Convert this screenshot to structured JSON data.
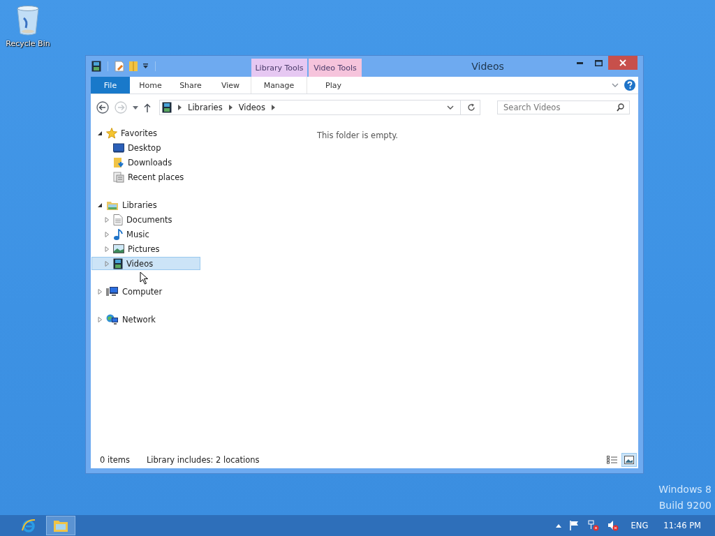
{
  "desktop_icons": [
    {
      "label": "Recycle Bin"
    }
  ],
  "window": {
    "title": "Videos",
    "contextual_headers": [
      {
        "label": "Library Tools",
        "color": "#e6c8f2"
      },
      {
        "label": "Video Tools",
        "color": "#f6c4dc"
      }
    ],
    "ribbon_tabs": [
      {
        "label": "File",
        "kind": "file",
        "selected": false
      },
      {
        "label": "Home",
        "kind": "plain",
        "selected": false
      },
      {
        "label": "Share",
        "kind": "plain",
        "selected": false
      },
      {
        "label": "View",
        "kind": "plain",
        "selected": false
      },
      {
        "label": "Manage",
        "kind": "contextual",
        "selected": false
      },
      {
        "label": "Play",
        "kind": "contextual",
        "selected": false
      }
    ],
    "address": {
      "crumbs": [
        "Libraries",
        "Videos"
      ]
    },
    "search": {
      "placeholder": "Search Videos"
    },
    "nav_tree": [
      {
        "label": "Favorites",
        "kind": "star",
        "expanded": true,
        "selected": false,
        "children": [
          {
            "label": "Desktop",
            "kind": "desktop",
            "selected": false
          },
          {
            "label": "Downloads",
            "kind": "downloads",
            "selected": false
          },
          {
            "label": "Recent places",
            "kind": "recent",
            "selected": false
          }
        ]
      },
      {
        "label": "Libraries",
        "kind": "library",
        "expanded": true,
        "selected": false,
        "children": [
          {
            "label": "Documents",
            "kind": "documents",
            "expanded": false,
            "selected": false
          },
          {
            "label": "Music",
            "kind": "music",
            "expanded": false,
            "selected": false
          },
          {
            "label": "Pictures",
            "kind": "pictures",
            "expanded": false,
            "selected": false
          },
          {
            "label": "Videos",
            "kind": "videos",
            "expanded": false,
            "selected": true
          }
        ]
      },
      {
        "label": "Computer",
        "kind": "computer",
        "expanded": false,
        "selected": false
      },
      {
        "label": "Network",
        "kind": "network",
        "expanded": false,
        "selected": false
      }
    ],
    "empty_message": "This folder is empty.",
    "status_bar": {
      "item_count": "0 items",
      "library_info": "Library includes: 2 locations",
      "view_buttons": [
        {
          "kind": "details",
          "selected": false
        },
        {
          "kind": "large-icons",
          "selected": true
        }
      ]
    }
  },
  "os_version": [
    "Windows 8",
    "Build 9200"
  ],
  "taskbar": {
    "apps": [
      {
        "kind": "browser",
        "selected": false
      },
      {
        "kind": "explorer",
        "selected": true
      }
    ],
    "language": "ENG",
    "clock": "11:46 PM"
  }
}
